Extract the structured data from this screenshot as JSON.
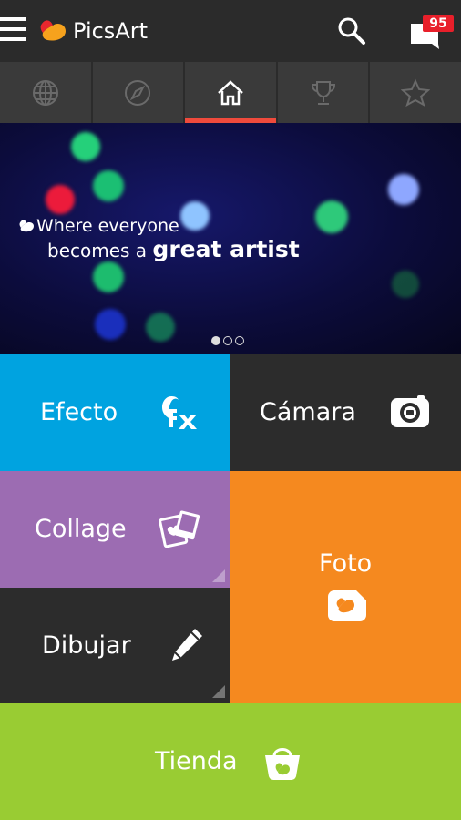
{
  "app": {
    "title": "PicsArt",
    "notification_count": "95"
  },
  "tabs": [
    {
      "icon": "globe-icon",
      "active": false
    },
    {
      "icon": "compass-icon",
      "active": false
    },
    {
      "icon": "home-icon",
      "active": true
    },
    {
      "icon": "trophy-icon",
      "active": false
    },
    {
      "icon": "star-icon",
      "active": false
    }
  ],
  "banner": {
    "line1": "Where everyone",
    "line2_prefix": "becomes a ",
    "line2_bold": "great artist",
    "pages": 3,
    "active_page": 1
  },
  "tiles": {
    "effect": {
      "label": "Efecto",
      "color": "#00a3e0",
      "icon": "fx-icon"
    },
    "camera": {
      "label": "Cámara",
      "color": "#2c2c2c",
      "icon": "camera-icon"
    },
    "collage": {
      "label": "Collage",
      "color": "#9c6cb2",
      "icon": "collage-icon"
    },
    "photo": {
      "label": "Foto",
      "color": "#f5891f",
      "icon": "photo-icon"
    },
    "draw": {
      "label": "Dibujar",
      "color": "#2c2c2c",
      "icon": "pencil-icon"
    },
    "shop": {
      "label": "Tienda",
      "color": "#99cc33",
      "icon": "shopping-basket-icon"
    }
  },
  "colors": {
    "accent": "#ef4a3c",
    "badge": "#e81f2a"
  }
}
